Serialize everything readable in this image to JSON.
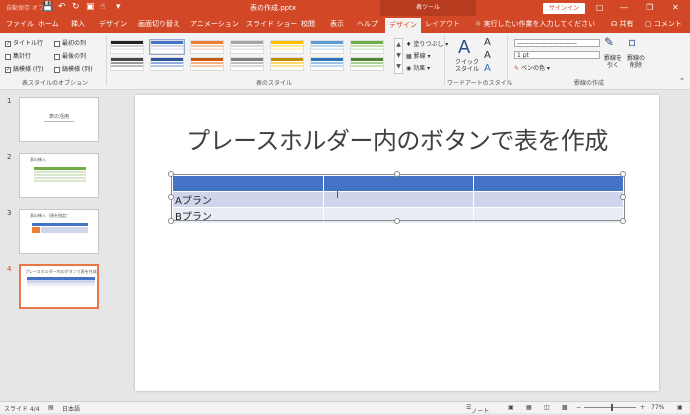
{
  "titlebar": {
    "autosave": "自動保存",
    "autosave_state": "オフ",
    "document_title": "表の作成.pptx",
    "context_tab_group": "表ツール",
    "signin_label": "サインイン",
    "qa_icons": [
      "save-icon",
      "undo-icon",
      "redo-icon",
      "start-from-beginning-icon",
      "touch-mode-icon",
      "customize-qa-icon"
    ]
  },
  "tabs": [
    "ファイル",
    "ホーム",
    "挿入",
    "デザイン",
    "画面切り替え",
    "アニメーション",
    "スライド ショー",
    "校閲",
    "表示",
    "ヘルプ",
    "デザイン",
    "レイアウト"
  ],
  "active_tab": "デザイン",
  "tell_me": "実行したい作業を入力してください",
  "share_label": "共有",
  "comment_label": "コメント",
  "ribbon": {
    "style_options": {
      "items": [
        {
          "label": "タイトル行",
          "checked": true
        },
        {
          "label": "最初の列",
          "checked": false
        },
        {
          "label": "集計行",
          "checked": false
        },
        {
          "label": "最後の列",
          "checked": false
        },
        {
          "label": "縞模様 (行)",
          "checked": true
        },
        {
          "label": "縞模様 (列)",
          "checked": false
        }
      ],
      "group_label": "表スタイルのオプション"
    },
    "table_styles": {
      "group_label": "表のスタイル",
      "shading_label": "塗りつぶし",
      "border_label": "罫線",
      "effect_label": "効果",
      "swatch_colors": [
        "#222222",
        "#4472c4",
        "#ed7d31",
        "#a5a5a5",
        "#ffc000",
        "#5b9bd5",
        "#70ad47"
      ]
    },
    "wordart": {
      "group_label": "ワードアートのスタイル",
      "quick_style_label": "クイック スタイル"
    },
    "borders": {
      "group_label": "罫線の作成",
      "pen_weight": "1 pt",
      "pen_color_label": "ペンの色",
      "draw_table_label": "罫線を引く",
      "eraser_label": "罫線の削除"
    }
  },
  "slides": [
    {
      "num": "1",
      "title": "表の活用"
    },
    {
      "num": "2",
      "title": "表の挿入"
    },
    {
      "num": "3",
      "title": "表の挿入（値を指定）"
    },
    {
      "num": "4",
      "title": "プレースホルダー内のボタンで表を作成"
    }
  ],
  "current_slide": {
    "title": "プレースホルダー内のボタンで表を作成",
    "table": {
      "rows": [
        [
          "",
          "",
          ""
        ],
        [
          "Aプラン",
          "",
          ""
        ],
        [
          "Bプラン",
          "",
          ""
        ]
      ]
    }
  },
  "status": {
    "slide_info": "スライド 4/4",
    "language": "日本語",
    "notes_label": "ノート",
    "zoom": "77%"
  }
}
